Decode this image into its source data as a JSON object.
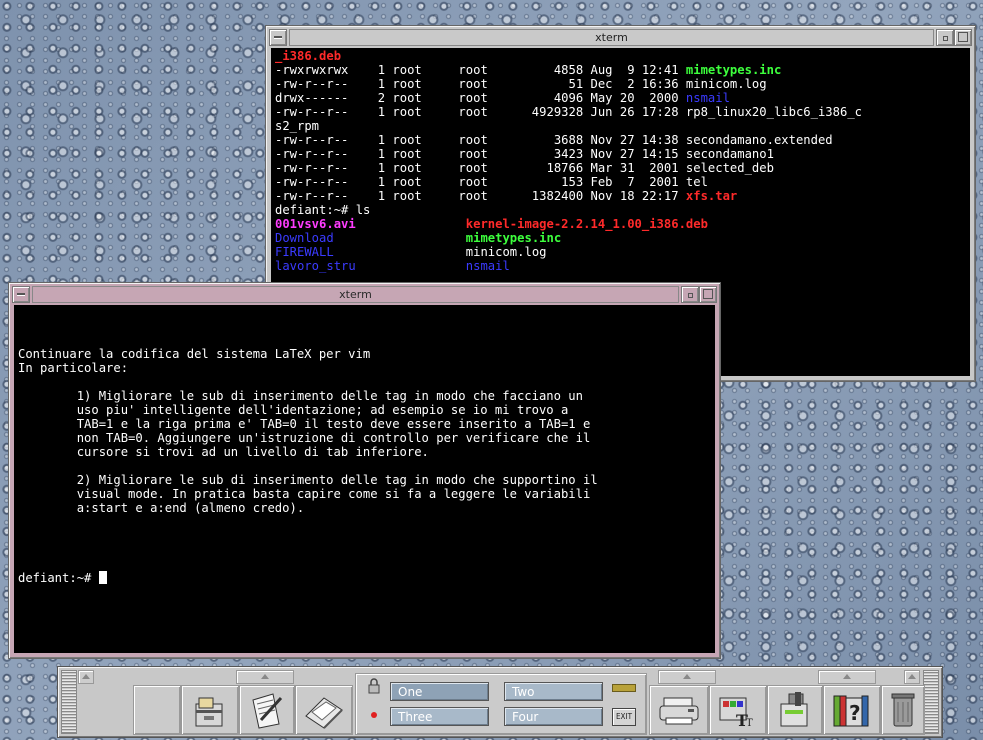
{
  "xterm_back": {
    "title": "xterm",
    "lines": [
      [
        {
          "t": "_i386.deb",
          "c": "red"
        }
      ],
      [
        {
          "t": "-rwxrwxrwx    1 root     root         4858 Aug  9 12:41 "
        },
        {
          "t": "mimetypes.inc",
          "c": "green"
        }
      ],
      [
        {
          "t": "-rw-r--r--    1 root     root           51 Dec  2 16:36 minicom.log"
        }
      ],
      [
        {
          "t": "drwx------    2 root     root         4096 May 20  2000 "
        },
        {
          "t": "nsmail",
          "c": "blue"
        }
      ],
      [
        {
          "t": "-rw-r--r--    1 root     root      4929328 Jun 26 17:28 rp8_linux20_libc6_i386_c"
        }
      ],
      [
        {
          "t": "s2_rpm"
        }
      ],
      [
        {
          "t": "-rw-r--r--    1 root     root         3688 Nov 27 14:38 secondamano.extended"
        }
      ],
      [
        {
          "t": "-rw-r--r--    1 root     root         3423 Nov 27 14:15 secondamano1"
        }
      ],
      [
        {
          "t": "-rw-r--r--    1 root     root        18766 Mar 31  2001 selected_deb"
        }
      ],
      [
        {
          "t": "-rw-r--r--    1 root     root          153 Feb  7  2001 tel"
        }
      ],
      [
        {
          "t": "-rw-r--r--    1 root     root      1382400 Nov 18 22:17 "
        },
        {
          "t": "xfs.tar",
          "c": "red"
        }
      ],
      [
        {
          "t": "defiant:~# ls"
        }
      ],
      [
        {
          "t": "001vsv6.avi               ",
          "c": "magenta"
        },
        {
          "t": "kernel-image-2.2.14_1.00_i386.deb",
          "c": "red"
        }
      ],
      [
        {
          "t": "Download                  ",
          "c": "blue"
        },
        {
          "t": "mimetypes.inc",
          "c": "green"
        }
      ],
      [
        {
          "t": "FIREWALL                  ",
          "c": "blue"
        },
        {
          "t": "minicom.log"
        }
      ],
      [
        {
          "t": "lavoro_stru               ",
          "c": "blue"
        },
        {
          "t": "nsmail",
          "c": "blue"
        }
      ]
    ]
  },
  "xterm_front": {
    "title": "xterm",
    "lines": [
      "Continuare la codifica del sistema LaTeX per vim",
      "In particolare:",
      "",
      "        1) Migliorare le sub di inserimento delle tag in modo che facciano un",
      "        uso piu' intelligente dell'identazione; ad esempio se io mi trovo a",
      "        TAB=1 e la riga prima e' TAB=0 il testo deve essere inserito a TAB=1 e",
      "        non TAB=0. Aggiungere un'istruzione di controllo per verificare che il",
      "        cursore si trovi ad un livello di tab inferiore.",
      "",
      "        2) Migliorare le sub di inserimento delle tag in modo che supportino il",
      "        visual mode. In pratica basta capire come si fa a leggere le variabili",
      "        a:start e a:end (almeno credo).",
      "",
      ""
    ],
    "prompt": "defiant:~# "
  },
  "panel": {
    "workspaces": [
      "One",
      "Two",
      "Three",
      "Four"
    ],
    "exit_label": "EXIT"
  },
  "colors": {
    "red": "#ff2a2a",
    "green": "#3dff3d",
    "blue": "#3b3bff",
    "magenta": "#ff3cff",
    "desktop": "#8093ab",
    "front_title": "#c6a6b4"
  },
  "icons": {
    "left_drawer": [
      "blank-slot",
      "file-manager-icon",
      "text-editor-icon",
      "mail-icon"
    ],
    "right_drawer": [
      "printer-icon",
      "style-manager-icon",
      "app-manager-icon",
      "help-books-icon",
      "trash-icon"
    ]
  }
}
